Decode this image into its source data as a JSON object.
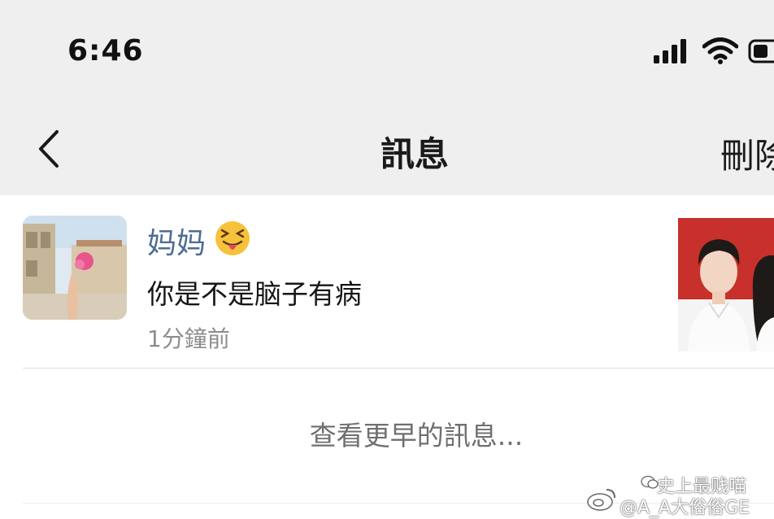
{
  "status_bar": {
    "time": "6:46",
    "icons": [
      "signal-icon",
      "wifi-icon",
      "battery-icon"
    ]
  },
  "nav": {
    "back_icon": "chevron-left-icon",
    "title": "訊息",
    "action_label": "刪除"
  },
  "notification": {
    "sender": "妈妈",
    "sender_emoji": "squinting-tongue-emoji",
    "message": "你是不是脑子有病",
    "time_ago": "1分鐘前"
  },
  "more_link": "查看更早的訊息...",
  "watermark": {
    "line1": "史上最贱喵",
    "line2": "@A_A大俗俗GE"
  },
  "colors": {
    "bar_bg": "#efefef",
    "sender": "#4f6c92",
    "timestamp": "#8d8d8d",
    "more_link": "#6f6f6f"
  }
}
